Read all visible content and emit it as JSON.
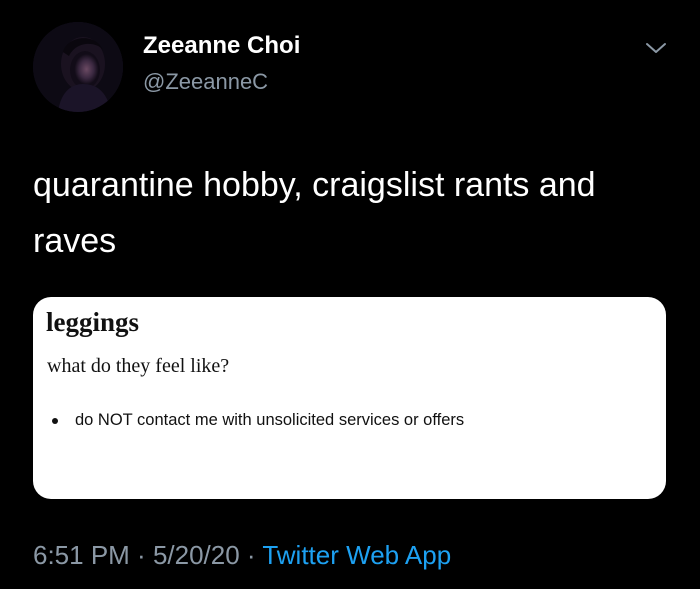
{
  "author": {
    "name": "Zeeanne Choi",
    "handle": "@ZeeanneC"
  },
  "tweet": {
    "text": "quarantine hobby, craigslist rants and raves"
  },
  "card": {
    "title": "leggings",
    "subtitle": "what do they feel like?",
    "bullets": [
      "do NOT contact me with unsolicited services or offers"
    ]
  },
  "meta": {
    "time": "6:51 PM",
    "separator": " · ",
    "date": "5/20/20",
    "source": "Twitter Web App"
  },
  "icons": {
    "menu": "chevron-down-icon"
  },
  "colors": {
    "background": "#000000",
    "text_primary": "#ffffff",
    "text_secondary": "#8b98a5",
    "link": "#1da1f2",
    "card_background": "#ffffff"
  }
}
